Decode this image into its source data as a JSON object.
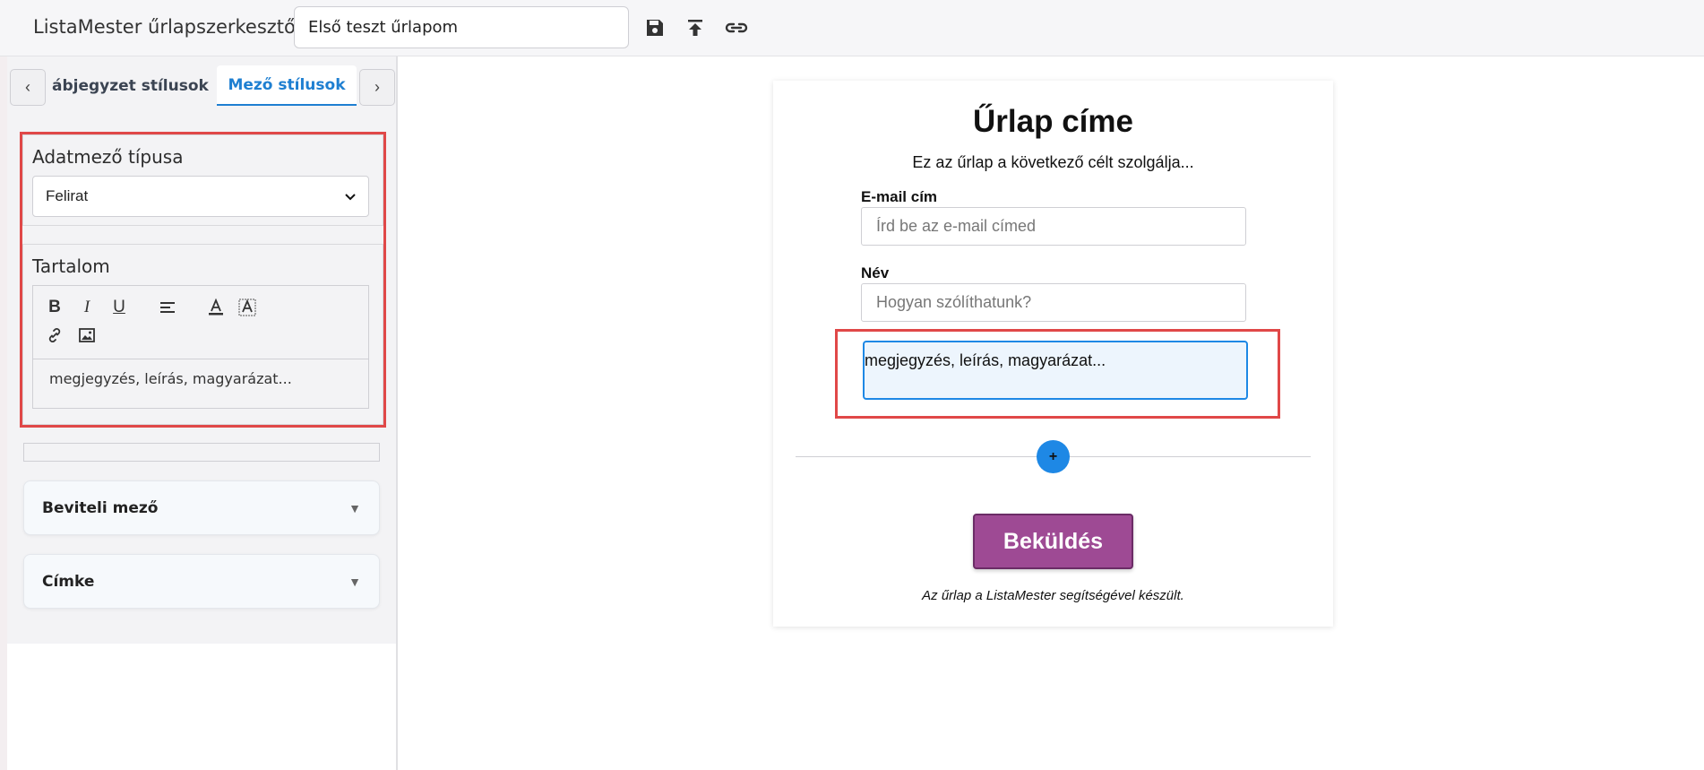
{
  "header": {
    "app_title": "ListaMester űrlapszerkesztő:",
    "form_name": "Első teszt űrlapom",
    "icons": [
      "save-icon",
      "upload-icon",
      "link-icon"
    ]
  },
  "sidebar": {
    "tabs": {
      "prev_arrow": "‹",
      "next_arrow": "›",
      "left_tab": "ábjegyzet stílusok",
      "active_tab": "Mező stílusok"
    },
    "field_type": {
      "label": "Adatmező típusa",
      "value": "Felirat"
    },
    "content": {
      "label": "Tartalom",
      "toolbar": [
        "bold",
        "italic",
        "underline",
        "align",
        "font-color",
        "background-color",
        "link",
        "image"
      ],
      "text": "megjegyzés, leírás, magyarázat..."
    },
    "accordions": [
      {
        "label": "Beviteli mező",
        "arrow": "▼"
      },
      {
        "label": "Címke",
        "arrow": "▼"
      }
    ],
    "accent_color": "#1e7fd1"
  },
  "form": {
    "title": "Űrlap címe",
    "description": "Ez az űrlap a következő célt szolgálja...",
    "fields": [
      {
        "label": "E-mail cím",
        "placeholder": "Írd be az e-mail címed"
      },
      {
        "label": "Név",
        "placeholder": "Hogyan szólíthatunk?"
      }
    ],
    "caption_text": "megjegyzés, leírás, magyarázat...",
    "add_symbol": "+",
    "submit_label": "Beküldés",
    "footer": "Az űrlap a ListaMester segítségével készült.",
    "colors": {
      "submit": "#9e4a94",
      "add_button": "#1e88e5",
      "highlight": "#e04848"
    }
  }
}
